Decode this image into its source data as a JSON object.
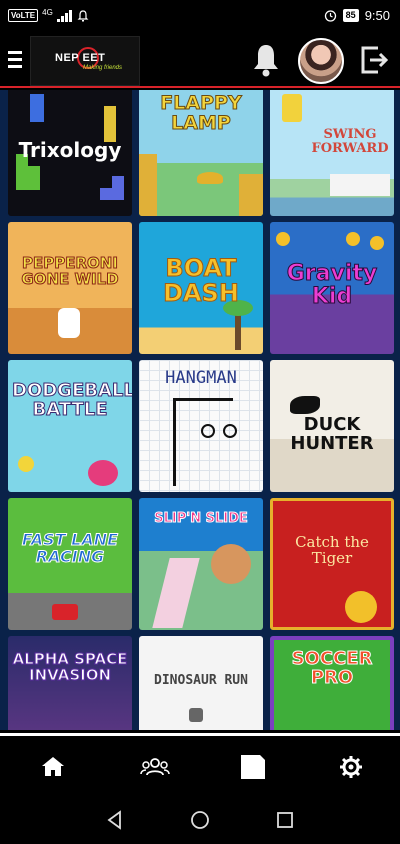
{
  "status_bar": {
    "volte": "VoLTE",
    "network": "4G",
    "battery": "85",
    "time": "9:50"
  },
  "header": {
    "logo_word": "NEP   EET",
    "logo_tagline": "Making friends"
  },
  "games": [
    {
      "title": "Trixology"
    },
    {
      "title": "FLAPPY LAMP"
    },
    {
      "title": "SWING FORWARD"
    },
    {
      "title": "PEPPERONI GONE WILD"
    },
    {
      "title": "BOAT DASH"
    },
    {
      "title": "Gravity Kid"
    },
    {
      "title": "DODGEBALL BATTLE"
    },
    {
      "title": "HANGMAN"
    },
    {
      "title": "DUCK HUNTER"
    },
    {
      "title": "FAST LANE RACING"
    },
    {
      "title": "SLIP'N SLIDE"
    },
    {
      "title": "Catch the Tiger"
    },
    {
      "title": "ALPHA SPACE INVASION"
    },
    {
      "title": "DINOSAUR RUN"
    },
    {
      "title": "SOCCER PRO"
    }
  ],
  "colors": {
    "accent": "#d9232a",
    "grid_background": "#0a2249"
  },
  "icons": {
    "menu": "menu-icon",
    "bell": "bell-icon",
    "logout": "logout-icon",
    "home": "home-icon",
    "people": "people-icon",
    "games": "games-icon",
    "settings": "gear-icon"
  }
}
